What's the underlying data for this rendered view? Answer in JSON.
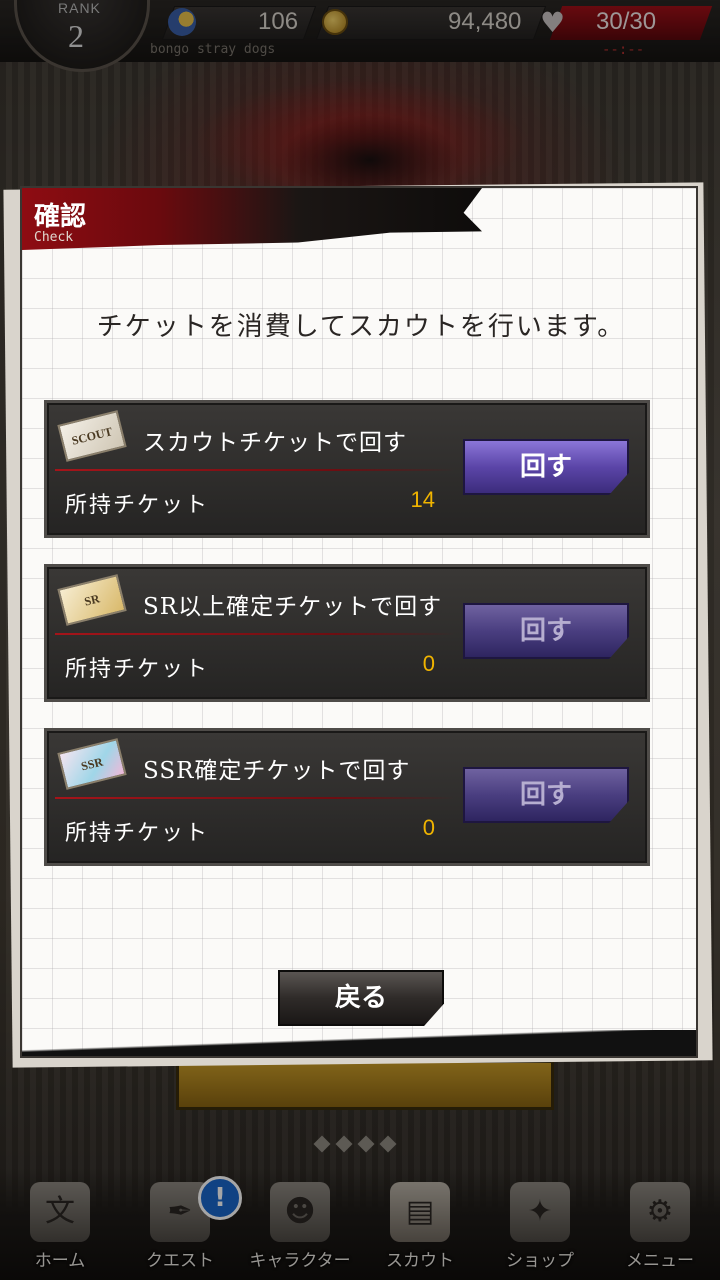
{
  "status_bar": {
    "rank_label": "RANK",
    "rank_value": "2",
    "ap_value": "106",
    "coins_value": "94,480",
    "stamina_value": "30/30",
    "stamina_timer": "--:--",
    "game_subtitle": "bongo stray dogs"
  },
  "dialog": {
    "title": "確認",
    "title_sub": "Check",
    "message": "チケットを消費してスカウトを行います。",
    "tickets": [
      {
        "icon_text": "SCOUT",
        "name": "スカウトチケットで回す",
        "owned_label": "所持チケット",
        "owned_count": "14",
        "button_label": "回す",
        "button_enabled": true
      },
      {
        "icon_text": "SR",
        "name": "SR以上確定チケットで回す",
        "owned_label": "所持チケット",
        "owned_count": "0",
        "button_label": "回す",
        "button_enabled": false
      },
      {
        "icon_text": "SSR",
        "name": "SSR確定チケットで回す",
        "owned_label": "所持チケット",
        "owned_count": "0",
        "button_label": "回す",
        "button_enabled": false
      }
    ],
    "back_label": "戻る"
  },
  "bottom_nav": {
    "items": [
      {
        "label": "ホーム",
        "icon": "home-icon"
      },
      {
        "label": "クエスト",
        "icon": "quest-icon",
        "badge": "!"
      },
      {
        "label": "キャラクター",
        "icon": "characters-icon"
      },
      {
        "label": "スカウト",
        "icon": "scout-icon",
        "active": true
      },
      {
        "label": "ショップ",
        "icon": "shop-icon"
      },
      {
        "label": "メニュー",
        "icon": "menu-gear-icon"
      }
    ]
  },
  "colors": {
    "accent_red": "#8e0c12",
    "button_purple": "#5b45a8",
    "count_gold": "#f0b400"
  }
}
